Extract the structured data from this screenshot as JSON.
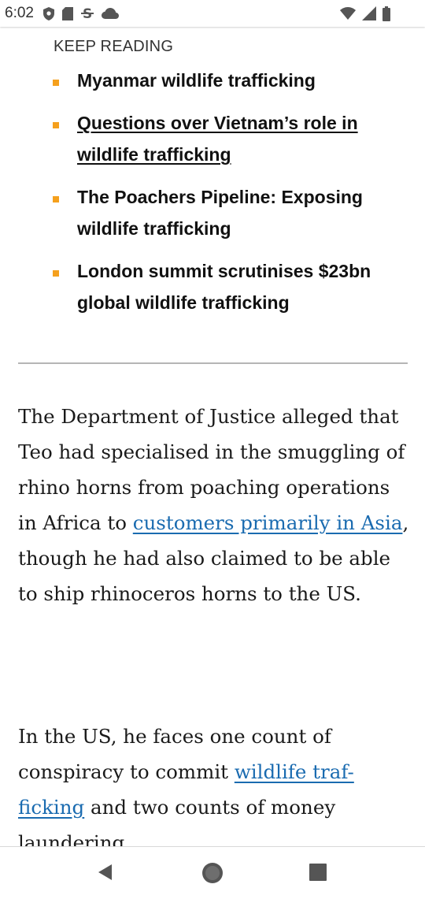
{
  "status_bar": {
    "time": "6:02",
    "left_icons": [
      "shield-icon",
      "sd-card-icon",
      "strikethrough-s-icon",
      "cloud-icon"
    ],
    "right_icons": [
      "wifi-icon",
      "signal-icon",
      "battery-icon"
    ]
  },
  "article": {
    "keep_reading_label": "KEEP READING",
    "related": [
      {
        "line1": "Myanmar wildlife trafficking",
        "line2": "",
        "underlined": false
      },
      {
        "line1": "Questions over Vietnam’s role in",
        "line2": "wildlife trafficking",
        "underlined": true
      },
      {
        "line1": "The Poachers Pipeline: Exposing",
        "line2": "wildlife trafficking",
        "underlined": false
      },
      {
        "line1": "London summit scrutinises $23bn",
        "line2": "global wildlife trafficking",
        "underlined": false
      }
    ],
    "paragraph1": {
      "text_before_link": "The Department of Justice alleged that Teo had specialised in the smuggling of rhino horns from poaching operations in Africa to ",
      "link_text": "customers primarily in Asia",
      "text_after_link": ", though he had also claimed to be able to ship rhinoceros horns to the US."
    },
    "paragraph2": {
      "text_before_link": "In the US, he faces one count of conspiracy to commit ",
      "link_text": "wildlife traf-ficking",
      "text_after_link": " and two counts of money laundering."
    }
  },
  "nav_bar": {
    "buttons": [
      "back-icon",
      "home-icon",
      "recents-icon"
    ]
  },
  "colors": {
    "bullet": "#f5a01d",
    "link": "#1a6bb0",
    "divider": "#b5b5b5",
    "text": "#1a1a1a"
  }
}
